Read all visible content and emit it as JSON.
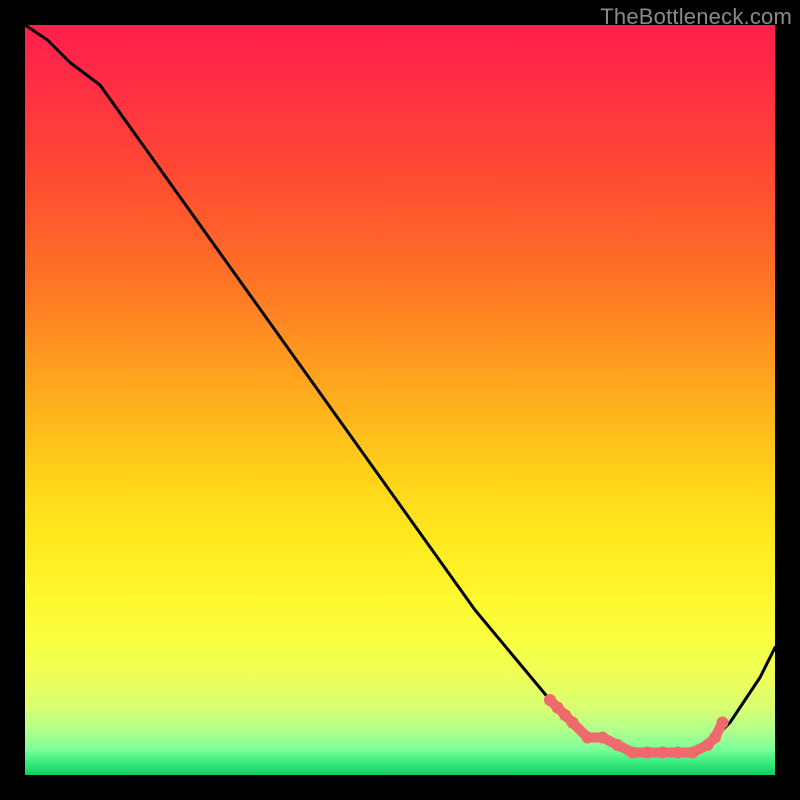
{
  "watermark": "TheBottleneck.com",
  "accent_dot_color": "#ef6a6c",
  "line_color": "#000000",
  "chart_data": {
    "type": "line",
    "title": "",
    "xlabel": "",
    "ylabel": "",
    "xlim": [
      0,
      100
    ],
    "ylim": [
      0,
      100
    ],
    "series": [
      {
        "name": "curve",
        "x": [
          0,
          3,
          6,
          10,
          15,
          20,
          25,
          30,
          35,
          40,
          45,
          50,
          55,
          60,
          65,
          70,
          73,
          76,
          79,
          82,
          85,
          88,
          90,
          92,
          94,
          96,
          98,
          100
        ],
        "y": [
          100,
          98,
          95,
          92,
          85,
          78,
          71,
          64,
          57,
          50,
          43,
          36,
          29,
          22,
          16,
          10,
          7,
          5,
          4,
          3,
          3,
          3,
          4,
          5,
          7,
          10,
          13,
          17
        ]
      }
    ],
    "marker_points": {
      "comment": "dotted coral segment near trough",
      "x": [
        70,
        71,
        72,
        73,
        75,
        77,
        79,
        81,
        83,
        85,
        87,
        89,
        91,
        92,
        93
      ],
      "y": [
        10,
        9,
        8,
        7,
        5,
        5,
        4,
        3,
        3,
        3,
        3,
        3,
        4,
        5,
        7
      ]
    }
  }
}
